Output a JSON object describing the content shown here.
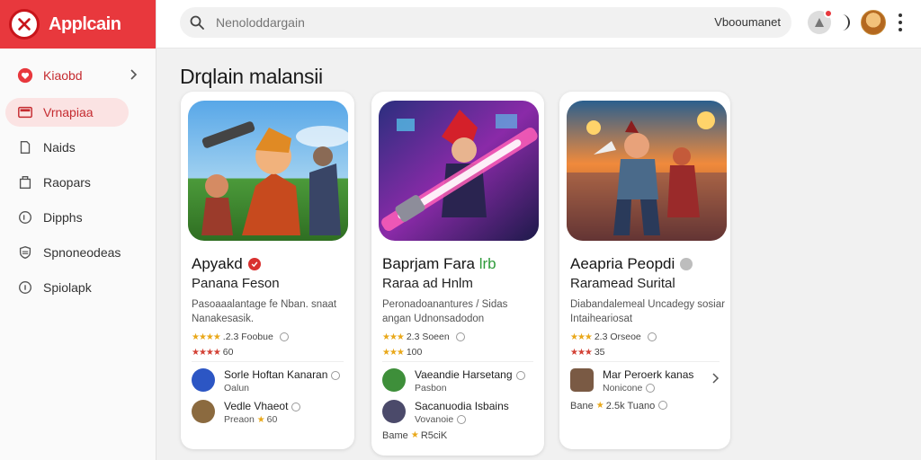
{
  "app": {
    "name": "Applcain"
  },
  "sidebar": {
    "items": [
      {
        "label": "Kiaobd",
        "icon": "heart-icon"
      },
      {
        "label": "Vrnapiaa",
        "icon": "folder-icon"
      },
      {
        "label": "Naids",
        "icon": "document-icon"
      },
      {
        "label": "Raopars",
        "icon": "bookmark-icon"
      },
      {
        "label": "Dipphs",
        "icon": "play-circle-icon"
      },
      {
        "label": "Spnoneodeas",
        "icon": "shield-icon"
      },
      {
        "label": "Spiolapk",
        "icon": "info-icon"
      }
    ]
  },
  "header": {
    "search_placeholder": "Nenoloddargain",
    "search_right": "Vbooumanet"
  },
  "main": {
    "title": "Drqlain malansii",
    "cards": [
      {
        "title": "Apyakd",
        "badge_color": "#d9302f",
        "subtitle": "Panana Feson",
        "desc": "Pasoaaalantage fe Nban. snaat Nanakesasik.",
        "rating_text": ".2.3 Foobue",
        "rating_count": "60",
        "reviews": [
          {
            "name": "Sorle Hoftan Kanaran",
            "meta": "Oalun"
          },
          {
            "name": "Vedle Vhaeot",
            "meta": "Preaon",
            "meta2": "60"
          }
        ]
      },
      {
        "title": "Baprjam Fara",
        "title_extra": "lrb",
        "badge_color": "#2e9b3a",
        "subtitle": "Raraa ad Hnlm",
        "desc": "Peronadoanantures / Sidas angan Udnonsadodon",
        "rating_text": "2.3 Soeen",
        "rating_count": "100",
        "reviews": [
          {
            "name": "Vaeandie Harsetang",
            "meta": "Pasbon"
          },
          {
            "name": "Sacanuodia Isbains",
            "meta": "Vovanoie"
          }
        ],
        "footer_label": "Bame",
        "footer_value": "R5ciK"
      },
      {
        "title": "Aeapria Peopdi",
        "badge_color": "#bdbdbd",
        "subtitle": "Raramead Surital",
        "desc": "Diabandalemeal Uncadegy sosiar Intaiheariosat",
        "rating_text": "2.3 Orseoe",
        "rating_count": "35",
        "reviews": [
          {
            "name": "Mar Peroerk kanas",
            "meta": "Nonicone"
          }
        ],
        "footer_label": "Bane",
        "footer_value": "2.5k Tuano"
      }
    ]
  },
  "colors": {
    "accent": "#e8383d",
    "accent_soft": "#fbe3e3",
    "star": "#e9a81a"
  }
}
